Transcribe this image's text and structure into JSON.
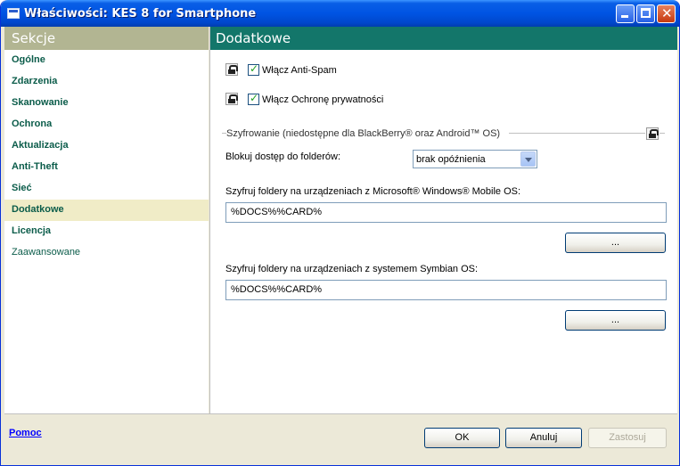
{
  "window": {
    "title": "Właściwości: KES 8 for Smartphone"
  },
  "sidebar": {
    "header": "Sekcje",
    "items": [
      {
        "label": "Ogólne"
      },
      {
        "label": "Zdarzenia"
      },
      {
        "label": "Skanowanie"
      },
      {
        "label": "Ochrona"
      },
      {
        "label": "Aktualizacja"
      },
      {
        "label": "Anti-Theft"
      },
      {
        "label": "Sieć"
      },
      {
        "label": "Dodatkowe",
        "selected": true
      },
      {
        "label": "Licencja"
      },
      {
        "label": "Zaawansowane"
      }
    ]
  },
  "main": {
    "header": "Dodatkowe",
    "antispam_label": "Włącz Anti-Spam",
    "privacy_label": "Włącz Ochronę prywatności",
    "encryption_group": "Szyfrowanie (niedostępne dla BlackBerry® oraz Android™ OS)",
    "block_label": "Blokuj dostęp do folderów:",
    "block_value": "brak opóźnienia",
    "winmobile_label": "Szyfruj foldery na urządzeniach z Microsoft® Windows® Mobile OS:",
    "winmobile_value": "%DOCS%%CARD%",
    "symbian_label": "Szyfruj foldery na urządzeniach z systemem Symbian OS:",
    "symbian_value": "%DOCS%%CARD%",
    "browse_label": "..."
  },
  "footer": {
    "help": "Pomoc",
    "ok": "OK",
    "cancel": "Anuluj",
    "apply": "Zastosuj"
  }
}
